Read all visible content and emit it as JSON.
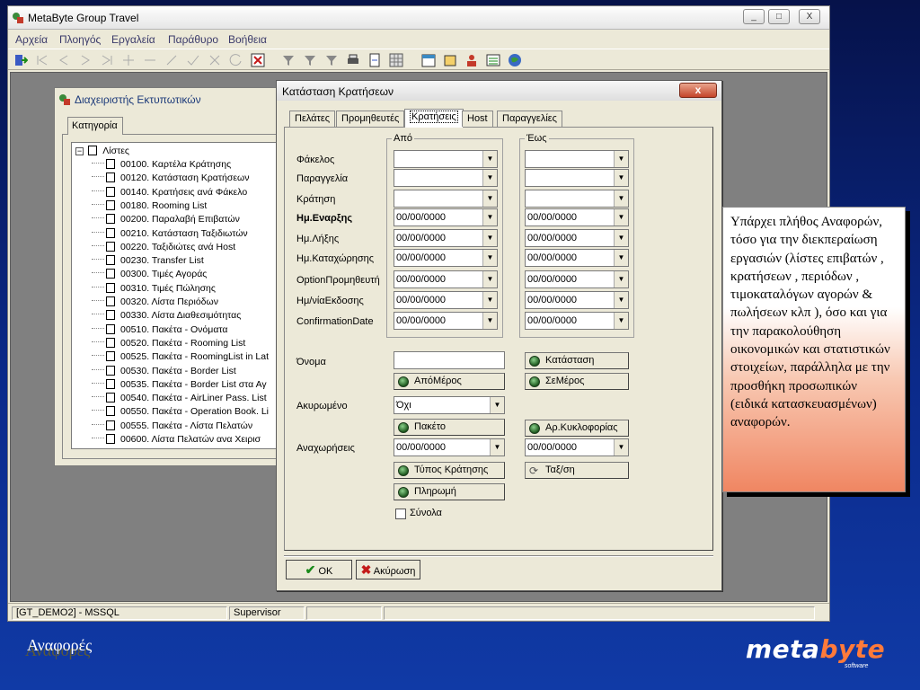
{
  "app": {
    "title": "MetaByte Group Travel",
    "menu": [
      "Αρχεία",
      "Πλοηγός",
      "Εργαλεία",
      "Παράθυρο",
      "Βοήθεια"
    ],
    "window_buttons": [
      "_",
      "□",
      "X"
    ],
    "status": [
      "[GT_DEMO2] - MSSQL",
      "Supervisor",
      "",
      ""
    ]
  },
  "printers_window": {
    "title": "Διαχειριστής Εκτυπωτικών",
    "tab": "Κατηγορία",
    "root": "Λίστες",
    "items": [
      "00100. Καρτέλα Κράτησης",
      "00120. Κατάσταση Κρατήσεων",
      "00140. Κρατήσεις ανά Φάκελο",
      "00180. Rooming List",
      "00200. Παραλαβή Επιβατών",
      "00210. Κατάσταση Ταξιδιωτών",
      "00220. Ταξιδιώτες ανά Host",
      "00230. Transfer List",
      "00300. Τιμές Αγοράς",
      "00310. Τιμές Πώλησης",
      "00320. Λίστα Περιόδων",
      "00330. Λίστα Διαθεσιμότητας",
      "00510. Πακέτα - Ονόματα",
      "00520. Πακέτα - Rooming List",
      "00525. Πακέτα - RoomingList in Lat",
      "00530. Πακέτα - Border List",
      "00535. Πακέτα - Border List στα Αγ",
      "00540. Πακέτα - AirLiner Pass. List",
      "00550. Πακέτα - Operation Book. Li",
      "00555. Πακέτα - Λίστα Πελατών",
      "00600. Λίστα Πελατών ανα Χειρισ"
    ]
  },
  "dialog": {
    "title": "Κατάσταση Κρατήσεων",
    "close": "x",
    "tabs": [
      "Πελάτες",
      "Προμηθευτές",
      "Κρατήσεις",
      "Host",
      "Παραγγελίες"
    ],
    "from_label": "Από",
    "to_label": "Έως",
    "fields": [
      {
        "label": "Φάκελος",
        "from": "",
        "to": "",
        "bold": false
      },
      {
        "label": "Παραγγελία",
        "from": "",
        "to": "",
        "bold": false
      },
      {
        "label": "Κράτηση",
        "from": "",
        "to": "",
        "bold": false
      },
      {
        "label": "Ημ.Εναρξης",
        "from": "00/00/0000",
        "to": "00/00/0000",
        "bold": true
      },
      {
        "label": "Ημ.Λήξης",
        "from": "00/00/0000",
        "to": "00/00/0000",
        "bold": false
      },
      {
        "label": "Ημ.Καταχώρησης",
        "from": "00/00/0000",
        "to": "00/00/0000",
        "bold": false
      },
      {
        "label": "OptionΠρομηθευτή",
        "from": "00/00/0000",
        "to": "00/00/0000",
        "bold": false
      },
      {
        "label": "Ημ/νίαΕκδοσης",
        "from": "00/00/0000",
        "to": "00/00/0000",
        "bold": false
      },
      {
        "label": "ConfirmationDate",
        "from": "00/00/0000",
        "to": "00/00/0000",
        "bold": false
      }
    ],
    "name_label": "Όνομα",
    "name_value": "",
    "cancelled_label": "Ακυρωμένο",
    "cancelled_value": "Όχι",
    "departures_label": "Αναχωρήσεις",
    "departures_from": "00/00/0000",
    "departures_to": "00/00/0000",
    "buttons": {
      "status": "Κατάσταση",
      "apomeros": "ΑπόΜέρος",
      "semeros": "ΣεΜέρος",
      "paketo": "Πακέτο",
      "arkykl": "Αρ.Κυκλοφορίας",
      "typos": "Τύπος Κράτησης",
      "taxsi": "Ταξ/ση",
      "pliromi": "Πληρωμή"
    },
    "totals_label": "Σύνολα",
    "ok": "OK",
    "cancel": "Ακύρωση"
  },
  "callout": "Υπάρχει πλήθος Αναφορών, τόσο για την διεκπεραίωση εργασιών (λίστες επιβατών , κρατήσεων , περιόδων , τιμοκαταλόγων αγορών & πωλήσεων κλπ ), όσο και για την παρακολούθηση οικονομικών και στατιστικών στοιχείων, παράλληλα με την προσθήκη προσωπικών (ειδικά κατασκευασμένων) αναφορών.",
  "footer": {
    "section": "Αναφορές",
    "logo_a": "meta",
    "logo_b": "byte",
    "logo_sub": "software"
  },
  "colors": {
    "accent": "#ff7a3a",
    "background": "#0b2a8a"
  }
}
